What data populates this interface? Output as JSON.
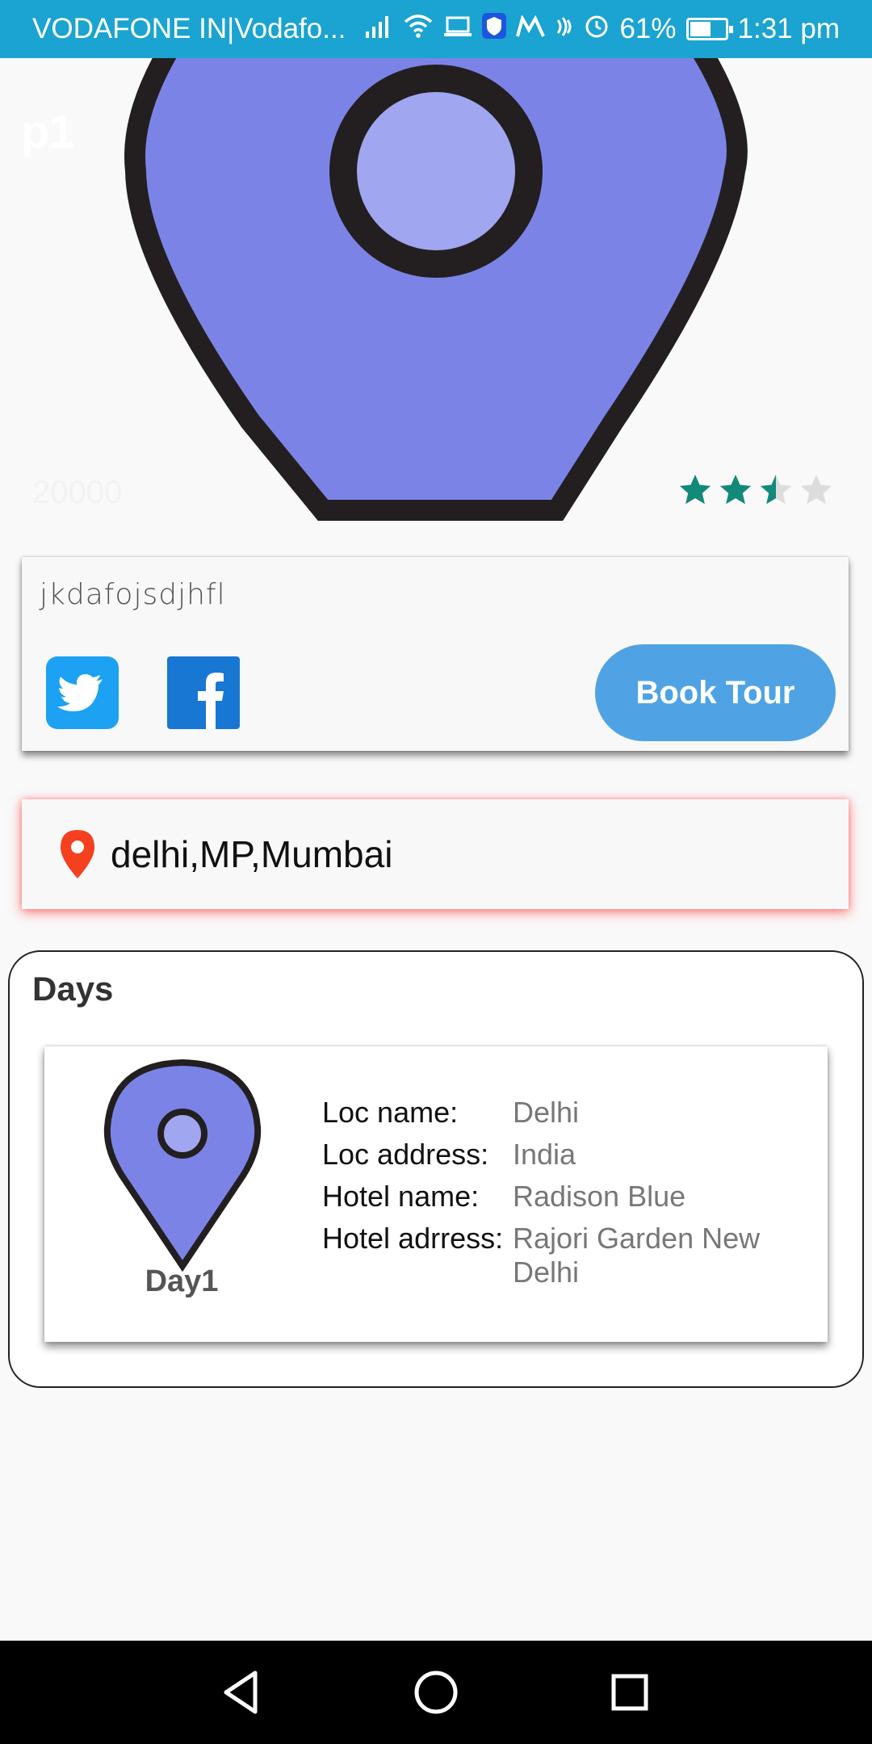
{
  "status_bar": {
    "carrier": "VODAFONE IN|Vodafo...",
    "battery": "61%",
    "time": "1:31 pm"
  },
  "hero": {
    "title": "p1",
    "price": "20000",
    "rating": 2.5,
    "rating_max": 5,
    "pin_color": "#7b84e6",
    "pin_inner_color": "#a1a6f0",
    "star_color": "#13897a"
  },
  "info_card": {
    "description": "jkdafojsdjhfl",
    "book_button": "Book Tour"
  },
  "location": {
    "text": "delhi,MP,Mumbai",
    "icon_color": "#f4401f"
  },
  "days": {
    "title": "Days",
    "items": [
      {
        "label": "Day1",
        "loc_name_key": "Loc name:",
        "loc_name": "Delhi",
        "loc_address_key": "Loc address:",
        "loc_address": "India",
        "hotel_name_key": "Hotel name:",
        "hotel_name": "Radison Blue",
        "hotel_address_key": "Hotel adrress:",
        "hotel_address": "Rajori Garden New Delhi"
      }
    ]
  },
  "icons": {
    "signal": "signal-icon",
    "wifi": "wifi-icon",
    "alarm": "alarm-icon",
    "battery": "battery-icon"
  }
}
